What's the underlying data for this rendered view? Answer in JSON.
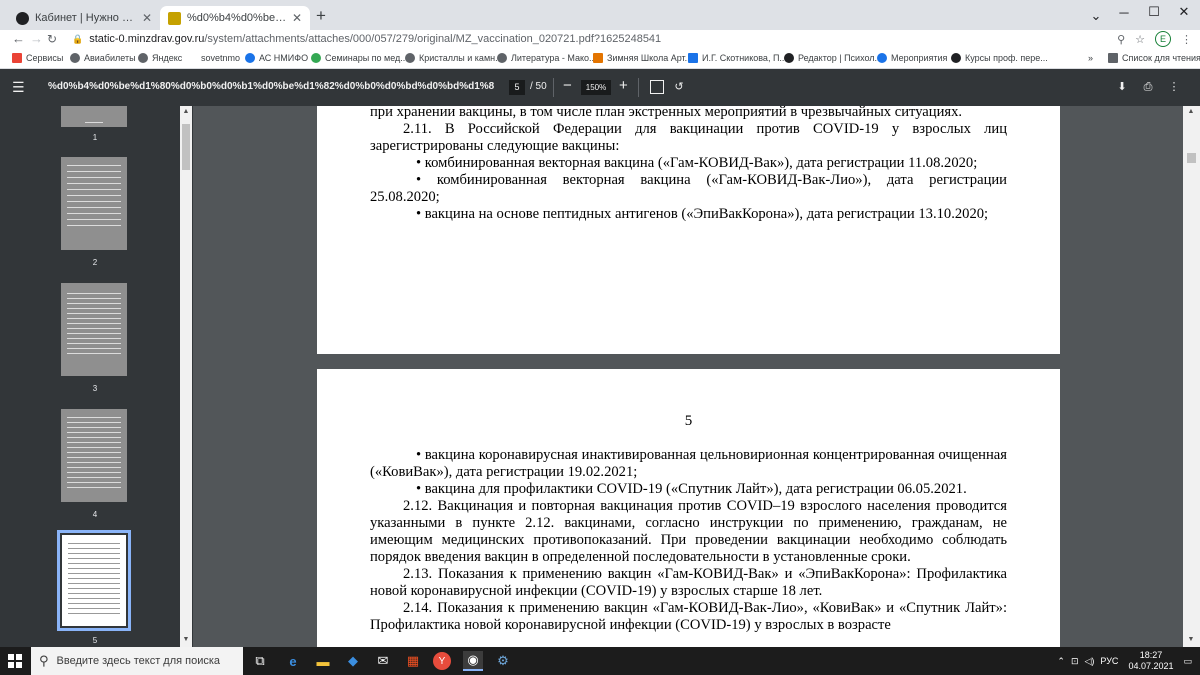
{
  "browser": {
    "tabs": [
      {
        "title": "Кабинет | Нужно ли сдавать ан...",
        "active": false
      },
      {
        "title": "%d0%b4%d0%be%d1%80%d0%...",
        "active": true
      }
    ],
    "new_tab": "+",
    "url_host": "static-0.minzdrav.gov.ru",
    "url_path": "/system/attachments/attaches/000/057/279/original/MZ_vaccination_020721.pdf?1625248541",
    "profile_initial": "E",
    "bookmarks": [
      "Сервисы",
      "Авиабилеты",
      "Яндекс",
      "sovetnmo",
      "АС НМИФО",
      "Семинары по мед...",
      "Кристаллы и камн...",
      "Литература - Мако...",
      "Зимняя Школа Арт...",
      "И.Г. Скотникова, П...",
      "Редактор | Психол...",
      "Мероприятия",
      "Курсы проф. пере..."
    ],
    "bookmarks_more": "»",
    "reading_list": "Список для чтения"
  },
  "pdf": {
    "filename": "%d0%b4%d0%be%d1%80%d0%b0%d0%b1%d0%be%d1%82%d0%b0%d0%bd%d0%bd%d1%8b%d0%b5%20%d0%9c...",
    "current_page": "5",
    "total_pages": "/ 50",
    "zoom": "150%",
    "thumbnail_labels": [
      "1",
      "2",
      "3",
      "4",
      "5"
    ]
  },
  "page_prev": {
    "lines": [
      "при хранении вакцины, в том числе план экстренных мероприятий в чрезвычайных ситуациях.",
      "2.11. В Российской Федерации для вакцинации против COVID-19 у взрослых лиц зарегистрированы следующие вакцины:",
      "• комбинированная векторная вакцина («Гам-КОВИД-Вак»), дата регистрации 11.08.2020;",
      "• комбинированная векторная вакцина («Гам-КОВИД-Вак-Лио»), дата регистрации 25.08.2020;",
      "• вакцина на основе пептидных антигенов («ЭпиВакКорона»), дата регистрации 13.10.2020;"
    ]
  },
  "page_cur": {
    "number": "5",
    "lines": [
      "• вакцина коронавирусная инактивированная цельновирионная концентрированная очищенная («КовиВак»), дата регистрации 19.02.2021;",
      "• вакцина для профилактики COVID-19 («Спутник Лайт»), дата регистрации 06.05.2021.",
      "2.12. Вакцинация и повторная вакцинация против COVID–19 взрослого населения проводится указанными в пункте 2.12. вакцинами, согласно инструкции по применению, гражданам, не имеющим медицинских противопоказаний. При проведении вакцинации необходимо соблюдать порядок введения вакцин в определенной последовательности в установленные сроки.",
      "2.13. Показания к применению вакцин «Гам-КОВИД-Вак» и «ЭпиВакКорона»: Профилактика новой коронавирусной инфекции (COVID-19) у взрослых старше 18 лет.",
      "2.14. Показания к применению вакцин «Гам-КОВИД-Вак-Лио», «КовиВак» и «Спутник Лайт»: Профилактика новой коронавирусной инфекции (COVID-19) у взрослых в возрасте"
    ]
  },
  "taskbar": {
    "search_placeholder": "Введите здесь текст для поиска",
    "lang": "РУС",
    "time": "18:27",
    "date": "04.07.2021"
  }
}
